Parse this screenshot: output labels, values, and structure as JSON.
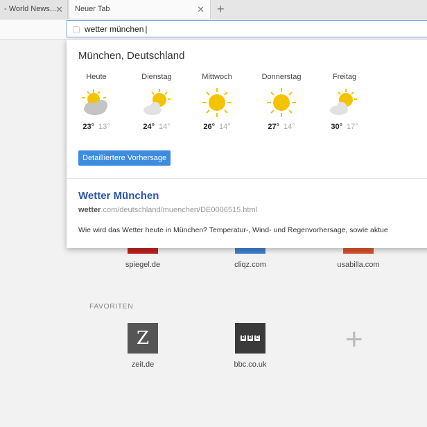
{
  "tabs": [
    {
      "label": "- World News...",
      "active": false
    },
    {
      "label": "Neuer Tab",
      "active": true
    }
  ],
  "toolbar": {
    "url_value": "wetter münchen"
  },
  "weather": {
    "location": "München, Deutschland",
    "days": [
      {
        "name": "Heute",
        "icon": "partly-cloudy-icon",
        "high": "23°",
        "low": "13°"
      },
      {
        "name": "Dienstag",
        "icon": "partly-cloudy-icon",
        "high": "24°",
        "low": "14°"
      },
      {
        "name": "Mittwoch",
        "icon": "sun-icon",
        "high": "26°",
        "low": "14°"
      },
      {
        "name": "Donnerstag",
        "icon": "sun-icon",
        "high": "27°",
        "low": "14°"
      },
      {
        "name": "Freitag",
        "icon": "partly-cloudy-icon",
        "high": "30°",
        "low": "17°"
      }
    ],
    "forecast_button": "Detailliertere Vorhersage"
  },
  "result": {
    "title": "Wetter München",
    "url_domain": "wetter",
    "url_rest": ".com/deutschland/muenchen/DE0006515.html",
    "description": "Wie wird das Wetter heute in München? Temperatur-, Wind- und Regenvorhersage, sowie aktue"
  },
  "top_sites": [
    {
      "label": "spiegel.de",
      "color": "#c0221b"
    },
    {
      "label": "cliqz.com",
      "color": "#3f7fd0"
    },
    {
      "label": "usabilla.com",
      "color": "#d9522c"
    }
  ],
  "favorites": {
    "heading": "FAVORITEN",
    "items": [
      {
        "label": "zeit.de",
        "glyph": "Z"
      },
      {
        "label": "bbc.co.uk",
        "glyph": "BBC"
      }
    ]
  }
}
